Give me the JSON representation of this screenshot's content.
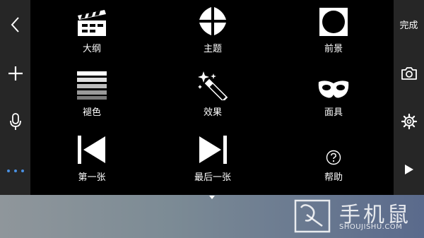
{
  "left_toolbar": {
    "back_icon": "chevron-left-icon",
    "add_icon": "plus-icon",
    "mic_icon": "microphone-icon",
    "more_icon": "ellipsis-icon"
  },
  "right_toolbar": {
    "done_label": "完成",
    "camera_icon": "camera-icon",
    "settings_icon": "gear-icon",
    "play_icon": "play-icon"
  },
  "menu": {
    "items": [
      {
        "label": "大纲",
        "icon": "clapperboard-icon"
      },
      {
        "label": "主题",
        "icon": "theme-icon"
      },
      {
        "label": "前景",
        "icon": "foreground-icon"
      },
      {
        "label": "褪色",
        "icon": "fade-icon"
      },
      {
        "label": "效果",
        "icon": "magic-wand-icon"
      },
      {
        "label": "面具",
        "icon": "mask-icon"
      },
      {
        "label": "第一张",
        "icon": "first-slide-icon"
      },
      {
        "label": "最后一张",
        "icon": "last-slide-icon"
      },
      {
        "label": "帮助",
        "icon": "help-icon"
      }
    ]
  },
  "colors": {
    "background": "#000000",
    "toolbar": "#262626",
    "icon": "#ffffff"
  }
}
